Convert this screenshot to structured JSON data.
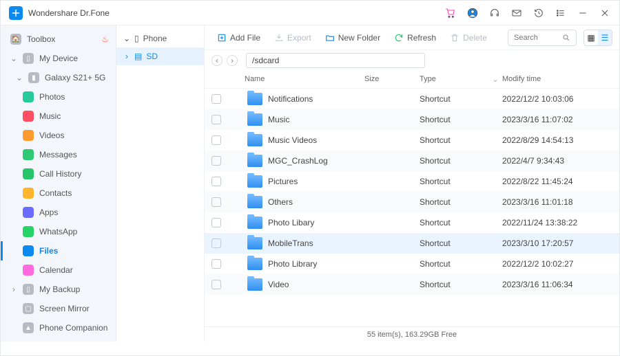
{
  "app_title": "Wondershare Dr.Fone",
  "sidebar": {
    "toolbox": "Toolbox",
    "my_device": "My Device",
    "galaxy": "Galaxy S21+ 5G",
    "items": [
      {
        "label": "Photos",
        "color": "#28c99b"
      },
      {
        "label": "Music",
        "color": "#ff4d63"
      },
      {
        "label": "Videos",
        "color": "#ff9b2e"
      },
      {
        "label": "Messages",
        "color": "#2ec973"
      },
      {
        "label": "Call History",
        "color": "#27c46a"
      },
      {
        "label": "Contacts",
        "color": "#ffb42e"
      },
      {
        "label": "Apps",
        "color": "#6b6bff"
      },
      {
        "label": "WhatsApp",
        "color": "#25d366"
      },
      {
        "label": "Files",
        "color": "#0d8af0"
      },
      {
        "label": "Calendar",
        "color": "#ff6bdf"
      }
    ],
    "my_backup": "My Backup",
    "screen_mirror": "Screen Mirror",
    "phone_companion": "Phone Companion"
  },
  "storage": {
    "phone": "Phone",
    "sd": "SD"
  },
  "toolbar": {
    "add": "Add File",
    "export": "Export",
    "newfolder": "New Folder",
    "refresh": "Refresh",
    "delete": "Delete"
  },
  "search_placeholder": "Search",
  "path": "/sdcard",
  "columns": {
    "name": "Name",
    "size": "Size",
    "type": "Type",
    "time": "Modify time"
  },
  "rows": [
    {
      "name": "Notifications",
      "type": "Shortcut",
      "time": "2022/12/2 10:03:06"
    },
    {
      "name": "Music",
      "type": "Shortcut",
      "time": "2023/3/16 11:07:02"
    },
    {
      "name": "Music Videos",
      "type": "Shortcut",
      "time": "2022/8/29 14:54:13"
    },
    {
      "name": "MGC_CrashLog",
      "type": "Shortcut",
      "time": "2022/4/7 9:34:43"
    },
    {
      "name": "Pictures",
      "type": "Shortcut",
      "time": "2022/8/22 11:45:24"
    },
    {
      "name": "Others",
      "type": "Shortcut",
      "time": "2023/3/16 11:01:18"
    },
    {
      "name": "Photo Libary",
      "type": "Shortcut",
      "time": "2022/11/24 13:38:22"
    },
    {
      "name": "MobileTrans",
      "type": "Shortcut",
      "time": "2023/3/10 17:20:57",
      "hover": true
    },
    {
      "name": "Photo Library",
      "type": "Shortcut",
      "time": "2022/12/2 10:02:27"
    },
    {
      "name": "Video",
      "type": "Shortcut",
      "time": "2023/3/16 11:06:34"
    }
  ],
  "status": "55 item(s), 163.29GB Free"
}
